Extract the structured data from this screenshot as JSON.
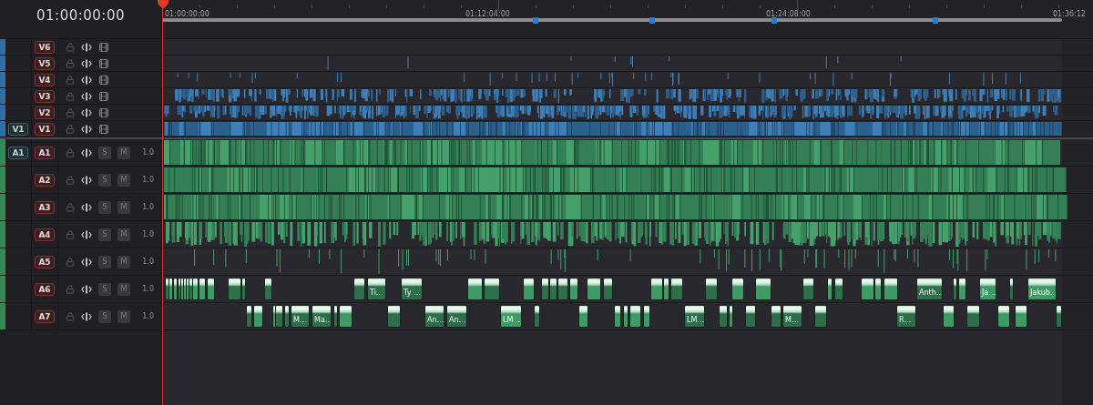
{
  "timecode": "01:00:00:00",
  "ruler": {
    "labels": [
      "01:00:00:00",
      "01:12:04:00",
      "01:24:08:00",
      "01:36:12"
    ]
  },
  "tracks": [
    {
      "kind": "video",
      "name": "V6"
    },
    {
      "kind": "video",
      "name": "V5"
    },
    {
      "kind": "video",
      "name": "V4"
    },
    {
      "kind": "video",
      "name": "V3"
    },
    {
      "kind": "video",
      "name": "V2"
    },
    {
      "kind": "video",
      "name": "V1",
      "source": "V1"
    },
    {
      "kind": "audio",
      "name": "A1",
      "source": "A1",
      "solo": "S",
      "mute": "M",
      "soloed": false,
      "muted": false,
      "volume": "1.0"
    },
    {
      "kind": "audio",
      "name": "A2",
      "solo": "S",
      "mute": "M",
      "soloed": false,
      "muted": false,
      "volume": "1.0"
    },
    {
      "kind": "audio",
      "name": "A3",
      "solo": "S",
      "mute": "M",
      "soloed": false,
      "muted": false,
      "volume": "1.0"
    },
    {
      "kind": "audio",
      "name": "A4",
      "solo": "S",
      "mute": "M",
      "soloed": false,
      "muted": false,
      "volume": "1.0"
    },
    {
      "kind": "audio",
      "name": "A5",
      "solo": "S",
      "mute": "M",
      "soloed": false,
      "muted": false,
      "volume": "1.0"
    },
    {
      "kind": "audio",
      "name": "A6",
      "solo": "S",
      "mute": "M",
      "soloed": false,
      "muted": false,
      "volume": "1.0",
      "clips": [
        {
          "label": "Ti…"
        },
        {
          "label": "Ty …"
        },
        {
          "label": "Anth…"
        },
        {
          "label": "Ja…"
        },
        {
          "label": "Jakub…"
        }
      ]
    },
    {
      "kind": "audio",
      "name": "A7",
      "solo": "S",
      "mute": "M",
      "soloed": false,
      "muted": false,
      "volume": "1.0",
      "clips": [
        {
          "label": "M…"
        },
        {
          "label": "Ma…"
        },
        {
          "label": "An…"
        },
        {
          "label": "An…"
        },
        {
          "label": "LM…"
        },
        {
          "label": "LM…"
        },
        {
          "label": "M…"
        },
        {
          "label": "R…"
        }
      ]
    }
  ]
}
